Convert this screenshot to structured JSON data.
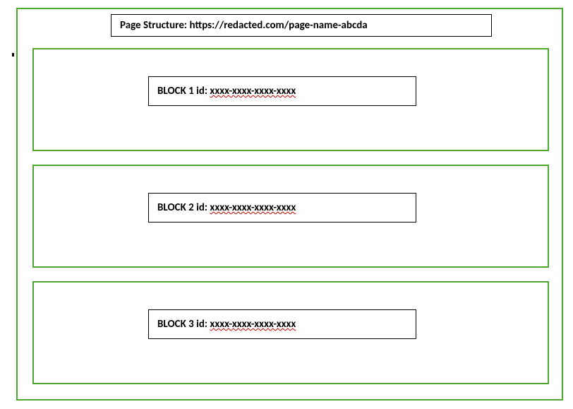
{
  "title": {
    "prefix": "Page Structure: ",
    "url": "https://redacted.com/page-name-abcda"
  },
  "blocks": [
    {
      "label_prefix": "BLOCK 1 id: ",
      "id_value": "xxxx-xxxx-xxxx-xxxx"
    },
    {
      "label_prefix": "BLOCK 2 id: ",
      "id_value": "xxxx-xxxx-xxxx-xxxx"
    },
    {
      "label_prefix": "BLOCK 3 id: ",
      "id_value": "xxxx-xxxx-xxxx-xxxx"
    }
  ]
}
